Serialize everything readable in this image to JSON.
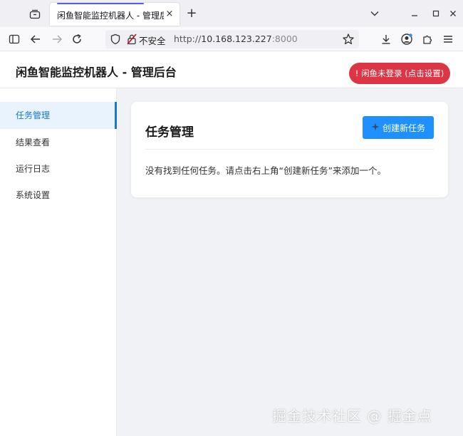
{
  "browser": {
    "tab_title": "闲鱼智能监控机器人 - 管理后台",
    "tab_close": "×",
    "new_tab": "+",
    "security_label": "不安全",
    "url_scheme": "http://",
    "url_host": "10.168.123.227",
    "url_port": ":8000"
  },
  "header": {
    "title": "闲鱼智能监控机器人 - 管理后台",
    "login_status": "! 闲鱼未登录 (点击设置)"
  },
  "sidebar": {
    "items": [
      {
        "label": "任务管理"
      },
      {
        "label": "结果查看"
      },
      {
        "label": "运行日志"
      },
      {
        "label": "系统设置"
      }
    ]
  },
  "main": {
    "title": "任务管理",
    "create_button": "创建新任务",
    "empty_message": "没有找到任何任务。请点击右上角“创建新任务”来添加一个。"
  },
  "watermark": "掘金技术社区 @ 掘金点",
  "colors": {
    "accent": "#1e90ff",
    "danger": "#dc3545",
    "active_nav": "#1677d6"
  }
}
